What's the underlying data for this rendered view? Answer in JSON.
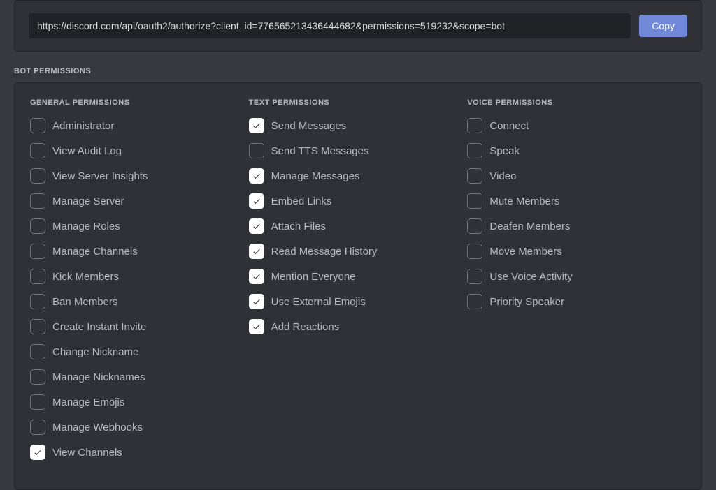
{
  "url_panel": {
    "url": "https://discord.com/api/oauth2/authorize?client_id=776565213436444682&permissions=519232&scope=bot",
    "copy_label": "Copy"
  },
  "permissions_section": {
    "title": "BOT PERMISSIONS",
    "columns": {
      "general": {
        "header": "GENERAL PERMISSIONS",
        "items": [
          {
            "label": "Administrator",
            "checked": false
          },
          {
            "label": "View Audit Log",
            "checked": false
          },
          {
            "label": "View Server Insights",
            "checked": false
          },
          {
            "label": "Manage Server",
            "checked": false
          },
          {
            "label": "Manage Roles",
            "checked": false
          },
          {
            "label": "Manage Channels",
            "checked": false
          },
          {
            "label": "Kick Members",
            "checked": false
          },
          {
            "label": "Ban Members",
            "checked": false
          },
          {
            "label": "Create Instant Invite",
            "checked": false
          },
          {
            "label": "Change Nickname",
            "checked": false
          },
          {
            "label": "Manage Nicknames",
            "checked": false
          },
          {
            "label": "Manage Emojis",
            "checked": false
          },
          {
            "label": "Manage Webhooks",
            "checked": false
          },
          {
            "label": "View Channels",
            "checked": true
          }
        ]
      },
      "text": {
        "header": "TEXT PERMISSIONS",
        "items": [
          {
            "label": "Send Messages",
            "checked": true
          },
          {
            "label": "Send TTS Messages",
            "checked": false
          },
          {
            "label": "Manage Messages",
            "checked": true
          },
          {
            "label": "Embed Links",
            "checked": true
          },
          {
            "label": "Attach Files",
            "checked": true
          },
          {
            "label": "Read Message History",
            "checked": true
          },
          {
            "label": "Mention Everyone",
            "checked": true
          },
          {
            "label": "Use External Emojis",
            "checked": true
          },
          {
            "label": "Add Reactions",
            "checked": true
          }
        ]
      },
      "voice": {
        "header": "VOICE PERMISSIONS",
        "items": [
          {
            "label": "Connect",
            "checked": false
          },
          {
            "label": "Speak",
            "checked": false
          },
          {
            "label": "Video",
            "checked": false
          },
          {
            "label": "Mute Members",
            "checked": false
          },
          {
            "label": "Deafen Members",
            "checked": false
          },
          {
            "label": "Move Members",
            "checked": false
          },
          {
            "label": "Use Voice Activity",
            "checked": false
          },
          {
            "label": "Priority Speaker",
            "checked": false
          }
        ]
      }
    }
  }
}
